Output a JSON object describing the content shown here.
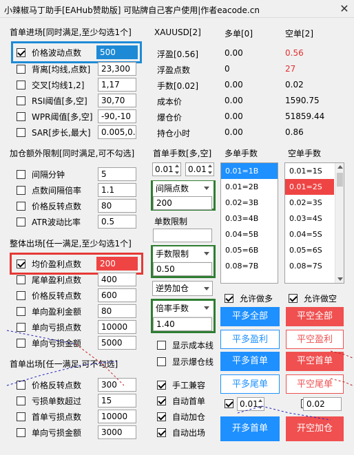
{
  "window": {
    "title": "小辣椒马丁助手[EAHub赞助版]  可贴牌自己客户使用|作者eacode.cn",
    "close": "✕"
  },
  "entry": {
    "title": "首单进场[同时满足,至少勾选1个]",
    "rows": [
      {
        "label": "价格波动点数",
        "value": "500",
        "checked": true
      },
      {
        "label": "背离[均线,点数]",
        "value": "23,300",
        "checked": false
      },
      {
        "label": "交叉[均线1,2]",
        "value": "1,17",
        "checked": false
      },
      {
        "label": "RSI阈值[多,空]",
        "value": "30,70",
        "checked": false
      },
      {
        "label": "WPR阈值[多,空]",
        "value": "-90,-10",
        "checked": false
      },
      {
        "label": "SAR[步长,最大]",
        "value": "0.005,0.2",
        "checked": false
      }
    ]
  },
  "addlimit": {
    "title": "加仓额外限制[同时满足,可不勾选]",
    "rows": [
      {
        "label": "间隔分钟",
        "value": "5"
      },
      {
        "label": "点数间隔倍率",
        "value": "1.1"
      },
      {
        "label": "价格反转点数",
        "value": "80"
      },
      {
        "label": "ATR波动比率",
        "value": "0.5"
      }
    ]
  },
  "overall_exit": {
    "title": "整体出场[任一满足,至少勾选1个]",
    "rows": [
      {
        "label": "均价盈利点数",
        "value": "200",
        "checked": true
      },
      {
        "label": "尾单盈利点数",
        "value": "400",
        "checked": false
      },
      {
        "label": "价格反转点数",
        "value": "600",
        "checked": false
      },
      {
        "label": "单向盈利金额",
        "value": "80",
        "checked": false
      },
      {
        "label": "单向亏损点数",
        "value": "10000",
        "checked": false
      },
      {
        "label": "单向亏损金额",
        "value": "5000",
        "checked": false
      }
    ]
  },
  "first_exit": {
    "title": "首单出场[任一满足,可不勾选]",
    "rows": [
      {
        "label": "价格反转点数",
        "value": "300"
      },
      {
        "label": "亏损单数超过",
        "value": "15"
      },
      {
        "label": "首单亏损点数",
        "value": "10000"
      },
      {
        "label": "单向亏损金额",
        "value": "3000"
      }
    ]
  },
  "stats": {
    "symbol": "XAUUSD[2]",
    "long_header": "多单[0]",
    "short_header": "空单[2]",
    "rows": [
      {
        "label": "浮盈[0.56]",
        "long": "0.00",
        "short": "0.56",
        "short_red": true
      },
      {
        "label": "浮盈点数",
        "long": "0",
        "short": "27",
        "short_red": true
      },
      {
        "label": "手数[0.02]",
        "long": "0.00",
        "short": "0.02",
        "short_red": false
      },
      {
        "label": "成本价",
        "long": "0.00",
        "short": "1590.75",
        "short_red": false
      },
      {
        "label": "爆仓价",
        "long": "0.00",
        "short": "51859.44",
        "short_red": false
      },
      {
        "label": "持仓小时",
        "long": "0.00",
        "short": "0.86",
        "short_red": false
      }
    ]
  },
  "lots": {
    "header": "首单手数[多,空]",
    "long_lot": "0.01",
    "short_lot": "0.01",
    "interval_label": "间隔点数",
    "interval_value": "200",
    "order_limit_label": "单数限制",
    "lot_limit_label": "手数限制",
    "lot_limit_value": "0.50",
    "reverse_label": "逆势加仓",
    "multiplier_label": "倍率手数",
    "multiplier_value": "1.40",
    "show_cost": "显示成本线",
    "show_liq": "显示爆仓线",
    "manual_compat": "手工兼容",
    "auto_first": "自动首单",
    "auto_add": "自动加仓",
    "auto_exit": "自动出场"
  },
  "long_list": {
    "header": "多单手数",
    "items": [
      "0.01=1B",
      "0.01=2B",
      "0.02=3B",
      "0.03=4B",
      "0.04=5B",
      "0.05=6B",
      "0.08=7B"
    ]
  },
  "short_list": {
    "header": "空单手数",
    "items": [
      "0.01=1S",
      "0.01=2S",
      "0.02=3S",
      "0.03=4S",
      "0.04=5S",
      "0.05=6S",
      "0.08=7S"
    ]
  },
  "actions": {
    "allow_long": "允许做多",
    "allow_short": "允许做空",
    "close_all_long": "平多全部",
    "close_all_short": "平空全部",
    "close_long_profit": "平多盈利",
    "close_short_profit": "平空盈利",
    "close_long_first": "平多首单",
    "close_short_first": "平空首单",
    "close_long_last": "平多尾单",
    "close_short_last": "平空尾单",
    "long_lot": "0.01",
    "short_lot": "0.02",
    "open_long_first": "开多首单",
    "open_short_add": "开空加仓"
  },
  "colors": {
    "blue": "#1e90ff",
    "red": "#f05050",
    "green": "#2e7d32",
    "highlight_blue": "#1e8ad6",
    "highlight_red": "#e53935"
  }
}
